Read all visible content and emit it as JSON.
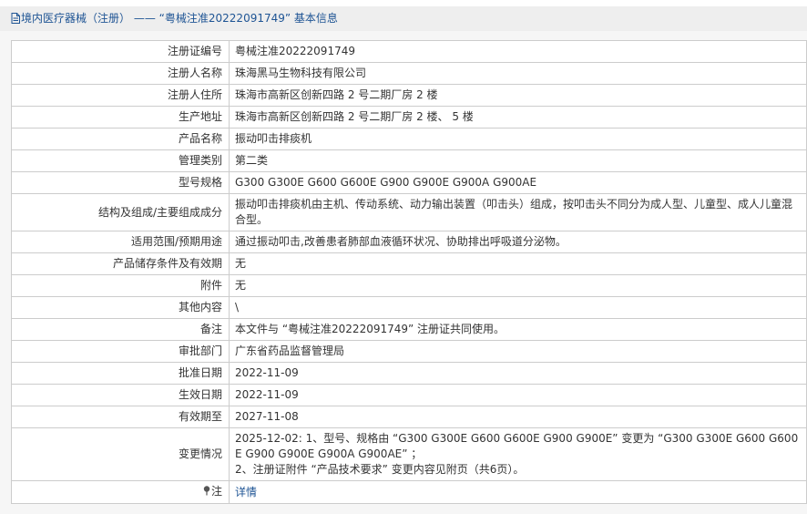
{
  "breadcrumb": {
    "section": "境内医疗器械（注册）",
    "separator": "——",
    "title": "“粤械注准20222091749” 基本信息"
  },
  "rows": [
    {
      "label": "注册证编号",
      "value": "粤械注准20222091749"
    },
    {
      "label": "注册人名称",
      "value": "珠海黑马生物科技有限公司"
    },
    {
      "label": "注册人住所",
      "value": "珠海市高新区创新四路 2 号二期厂房 2 楼"
    },
    {
      "label": "生产地址",
      "value": "珠海市高新区创新四路 2 号二期厂房 2 楼、 5 楼"
    },
    {
      "label": "产品名称",
      "value": "振动叩击排痰机"
    },
    {
      "label": "管理类别",
      "value": "第二类"
    },
    {
      "label": "型号规格",
      "value": "G300 G300E G600 G600E G900 G900E G900A G900AE"
    },
    {
      "label": "结构及组成/主要组成成分",
      "value": "振动叩击排痰机由主机、传动系统、动力输出装置（叩击头）组成，按叩击头不同分为成人型、儿童型、成人儿童混合型。"
    },
    {
      "label": "适用范围/预期用途",
      "value": "通过振动叩击,改善患者肺部血液循环状况、协助排出呼吸道分泌物。"
    },
    {
      "label": "产品储存条件及有效期",
      "value": "无"
    },
    {
      "label": "附件",
      "value": "无"
    },
    {
      "label": "其他内容",
      "value": "\\"
    },
    {
      "label": "备注",
      "value": "本文件与 “粤械注准20222091749” 注册证共同使用。"
    },
    {
      "label": "审批部门",
      "value": "广东省药品监督管理局"
    },
    {
      "label": "批准日期",
      "value": "2022-11-09"
    },
    {
      "label": "生效日期",
      "value": "2022-11-09"
    },
    {
      "label": "有效期至",
      "value": "2027-11-08"
    }
  ],
  "change": {
    "label": "变更情况",
    "line1": "2025-12-02: 1、型号、规格由 “G300 G300E G600 G600E G900 G900E” 变更为 “G300 G300E G600 G600E G900 G900E G900A G900AE” ；",
    "line2": "2、注册证附件 “产品技术要求” 变更内容见附页（共6页）。"
  },
  "note": {
    "label": "注",
    "link": "详情"
  },
  "colors": {
    "link": "#1e5494",
    "border": "#cccccc",
    "header_bg": "#eeeeee",
    "content_bg": "#f6f6f6"
  },
  "icons": {
    "breadcrumb": "document-icon",
    "note": "pin-icon"
  }
}
